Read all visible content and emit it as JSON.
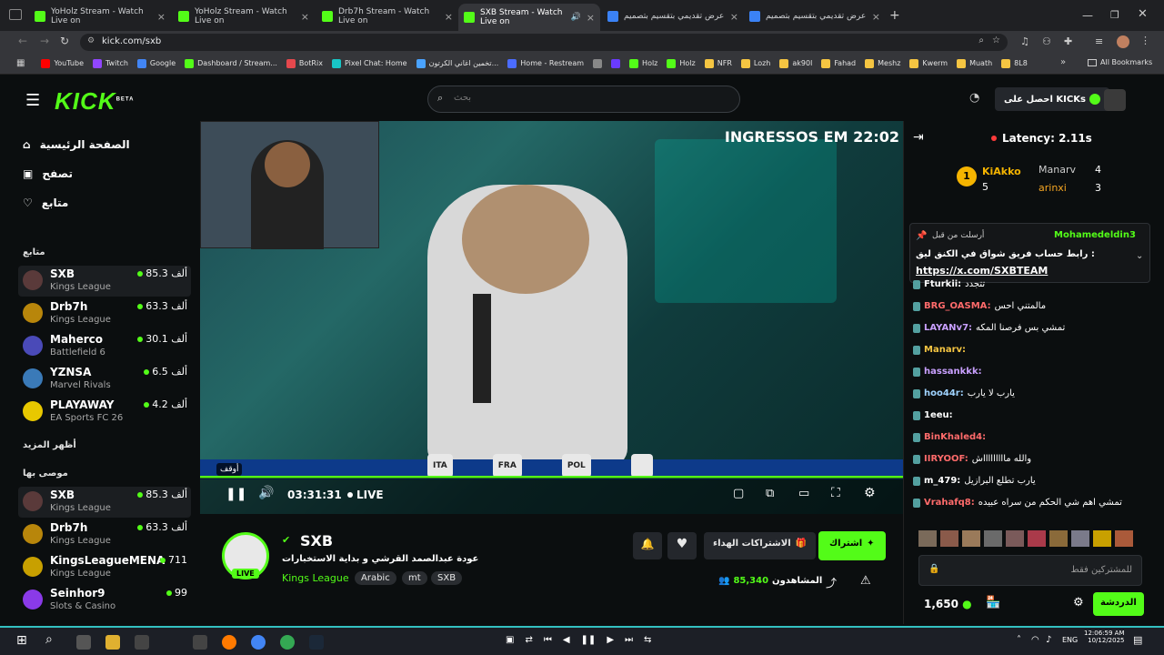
{
  "browser": {
    "tabs": [
      {
        "title": "YoHolz Stream - Watch Live on",
        "fav": "#53fc18",
        "close": "×"
      },
      {
        "title": "YoHolz Stream - Watch Live on",
        "fav": "#53fc18",
        "close": "×"
      },
      {
        "title": "Drb7h Stream - Watch Live on",
        "fav": "#53fc18",
        "close": "×"
      },
      {
        "title": "SXB Stream - Watch Live on",
        "fav": "#53fc18",
        "close": "×"
      },
      {
        "title": "عرض تقديمي بتقسيم بتصميم",
        "fav": "#3b82f6",
        "close": "×"
      },
      {
        "title": "عرض تقديمي بتقسيم بتصميم",
        "fav": "#3b82f6",
        "close": "×"
      }
    ],
    "new_tab": "+",
    "url": "kick.com/sxb",
    "bookmarks": [
      {
        "label": "YouTube",
        "color": "#ff0000"
      },
      {
        "label": "Twitch",
        "color": "#9146ff"
      },
      {
        "label": "Google",
        "color": "#4285f4"
      },
      {
        "label": "Dashboard / Stream...",
        "color": "#53fc18"
      },
      {
        "label": "BotRix",
        "color": "#e5484d"
      },
      {
        "label": "Pixel Chat: Home",
        "color": "#18c6c6"
      },
      {
        "label": "تخمين اغاني الكرتون...",
        "color": "#4aa3ff"
      },
      {
        "label": "Home - Restream",
        "color": "#4b6cff"
      },
      {
        "label": "",
        "color": "#888"
      },
      {
        "label": "",
        "color": "#6a3bff"
      },
      {
        "label": "Holz",
        "color": "#53fc18"
      },
      {
        "label": "Holz",
        "color": "#53fc18"
      },
      {
        "label": "NFR",
        "color": "#f5c542"
      },
      {
        "label": "Lozh",
        "color": "#f5c542"
      },
      {
        "label": "ak90l",
        "color": "#f5c542"
      },
      {
        "label": "Fahad",
        "color": "#f5c542"
      },
      {
        "label": "Meshz",
        "color": "#f5c542"
      },
      {
        "label": "Kwerm",
        "color": "#f5c542"
      },
      {
        "label": "Muath",
        "color": "#f5c542"
      },
      {
        "label": "8L8",
        "color": "#f5c542"
      }
    ],
    "more_bookmarks": "»",
    "all_bookmarks": "All Bookmarks"
  },
  "kick": {
    "logo": "KICK",
    "logo_badge": "BETA",
    "search_placeholder": "بحث",
    "get_kicks": "احصل على KICKs"
  },
  "sidebar": {
    "nav": [
      {
        "label": "الصفحة الرئيسية",
        "icon": "home-icon"
      },
      {
        "label": "تصفح",
        "icon": "browse-icon"
      },
      {
        "label": "متابع",
        "icon": "heart-icon"
      }
    ],
    "following_title": "متابع",
    "following": [
      {
        "name": "SXB",
        "game": "Kings League",
        "viewers": "85.3 ألف",
        "color": "#5a3a3a"
      },
      {
        "name": "Drb7h",
        "game": "Kings League",
        "viewers": "63.3 ألف",
        "color": "#b8860b"
      },
      {
        "name": "Maherco",
        "game": "Battlefield 6",
        "viewers": "30.1 ألف",
        "color": "#4a4ab8"
      },
      {
        "name": "YZNSA",
        "game": "Marvel Rivals",
        "viewers": "6.5 ألف",
        "color": "#3a7ab8"
      },
      {
        "name": "PLAYAWAY",
        "game": "EA Sports FC 26",
        "viewers": "4.2 ألف",
        "color": "#e8c800"
      }
    ],
    "show_more": "أظهر المزيد",
    "recommended_title": "موصى بها",
    "recommended": [
      {
        "name": "SXB",
        "game": "Kings League",
        "viewers": "85.3 ألف",
        "color": "#5a3a3a"
      },
      {
        "name": "Drb7h",
        "game": "Kings League",
        "viewers": "63.3 ألف",
        "color": "#b8860b"
      },
      {
        "name": "KingsLeagueMENA",
        "game": "Kings League",
        "viewers": "711",
        "color": "#c8a000"
      },
      {
        "name": "Seinhor9",
        "game": "Slots & Casino",
        "viewers": "99",
        "color": "#8a3ae8"
      }
    ]
  },
  "video": {
    "overlay_text": "INGRESSOS EM 22:02",
    "pause_label": "أوقف",
    "time": "03:31:31",
    "live": "LIVE",
    "flags": [
      "ITA",
      "FRA",
      "POL"
    ]
  },
  "streamer": {
    "name": "SXB",
    "live_badge": "LIVE",
    "title": "عودة عبدالصمد القرشي و بداية الاستخبارات",
    "category": "Kings League",
    "tags": [
      "Arabic",
      "mt",
      "SXB"
    ],
    "subscribe": "اشتراك",
    "gift_subs": "الاشتراكات الهداء",
    "viewers_label": "المشاهدون",
    "viewers": "85,340"
  },
  "chat": {
    "latency": "Latency: 2.11s",
    "leaderboard": [
      {
        "rank": "1",
        "name": "KiAkko",
        "count": "5"
      },
      {
        "name": "Manarv",
        "count": "4"
      },
      {
        "name": "arinxi",
        "count": "3"
      }
    ],
    "pinned": {
      "author": "Mohamedeldin3",
      "sent_by": "أرسلت من قبل",
      "text": "رابط حساب فريق شواق في الكنق ليق :",
      "link": "https://x.com/SXBTEAM"
    },
    "messages": [
      {
        "user": "Fturkii:",
        "text": "تتجدد",
        "color": "#fff"
      },
      {
        "user": "BRG_OASMA:",
        "text": "مالمتني احس",
        "color": "#ff6b6b"
      },
      {
        "user": "LAYANv7:",
        "text": "تمشي بس فرصنا المكه",
        "color": "#c9a0ff"
      },
      {
        "user": "Manarv:",
        "text": "",
        "color": "#f5c542"
      },
      {
        "user": "hassankkk:",
        "text": "",
        "color": "#c9a0ff"
      },
      {
        "user": "hoo44r:",
        "text": "يارب لا يارب",
        "color": "#9fd3ff"
      },
      {
        "user": "1eeu:",
        "text": "",
        "color": "#fff"
      },
      {
        "user": "BinKhaled4:",
        "text": "",
        "color": "#ff6b6b"
      },
      {
        "user": "IIRYOOF:",
        "text": "والله ماااااااااش",
        "color": "#ff6b6b"
      },
      {
        "user": "m_479:",
        "text": "يارب تطلع البرازيل",
        "color": "#fff"
      },
      {
        "user": "Vrahafq8:",
        "text": "تمشي اهم شي الحكم من سراه عبيده",
        "color": "#ff6b6b"
      }
    ],
    "input_placeholder": "للمشتركين فقط",
    "points": "1,650",
    "chat_button": "الدردشة"
  },
  "taskbar": {
    "lang": "ENG",
    "time": "12:06:59 AM",
    "date": "10/12/2025"
  }
}
